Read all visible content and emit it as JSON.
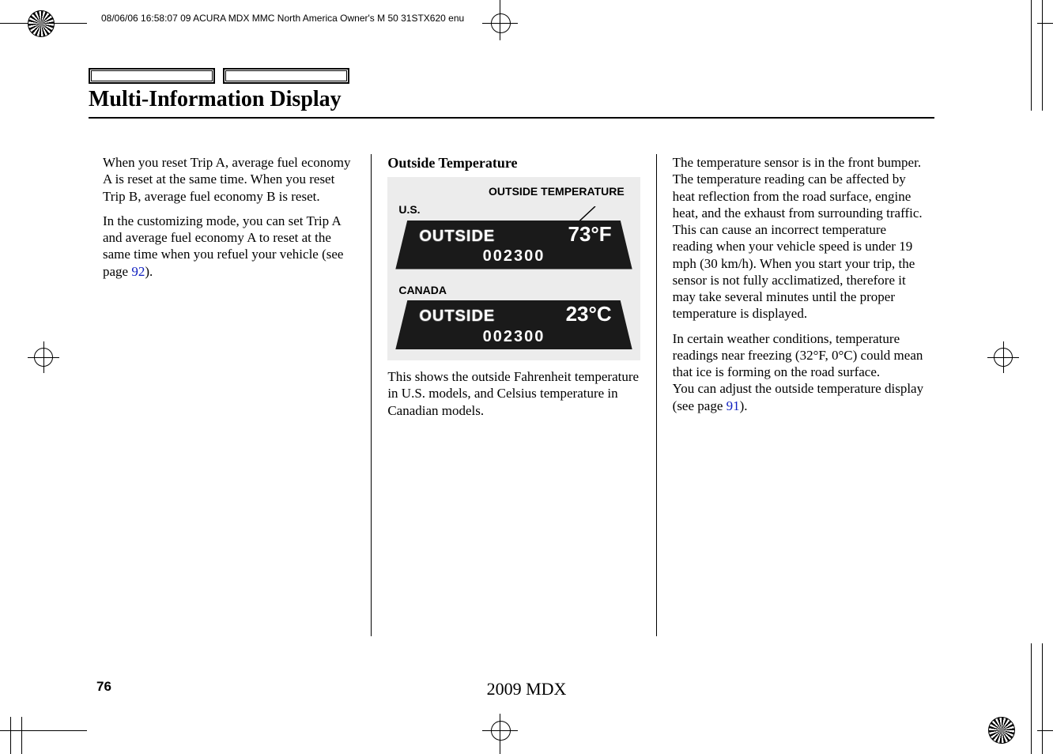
{
  "print_header": "08/06/06 16:58:07    09 ACURA MDX MMC North America Owner's M 50 31STX620 enu",
  "page_title": "Multi-Information Display",
  "col1": {
    "p1": "When you reset Trip A, average fuel economy A is reset at the same time. When you reset Trip B, average fuel economy B is reset.",
    "p2_a": "In the customizing mode, you can set Trip A and average fuel economy A to reset at the same time when you refuel your vehicle (see page ",
    "p2_link": "92",
    "p2_b": ")."
  },
  "col2": {
    "subhead": "Outside Temperature",
    "label_top": "OUTSIDE TEMPERATURE",
    "label_us": "U.S.",
    "lcd_us_text": "OUTSIDE",
    "lcd_us_temp": "73°F",
    "lcd_us_num": "002300",
    "label_ca": "CANADA",
    "lcd_ca_text": "OUTSIDE",
    "lcd_ca_temp": "23°C",
    "lcd_ca_num": "002300",
    "p1": "This shows the outside Fahrenheit temperature in U.S. models, and Celsius temperature in Canadian models."
  },
  "col3": {
    "p1": "The temperature sensor is in the front bumper. The temperature reading can be affected by heat reflection from the road surface, engine heat, and the exhaust from surrounding traffic. This can cause an incorrect temperature reading when your vehicle speed is under 19 mph (30 km/h). When you start your trip, the sensor is not fully acclimatized, therefore it may take several minutes until the proper temperature is displayed.",
    "p2_a": "In certain weather conditions, temperature readings near freezing (32°F, 0°C) could mean that ice is forming on the road surface.",
    "p2_b": "You can adjust the outside temperature display (see page ",
    "p2_link": "91",
    "p2_c": ")."
  },
  "page_number": "76",
  "footer": "2009  MDX"
}
